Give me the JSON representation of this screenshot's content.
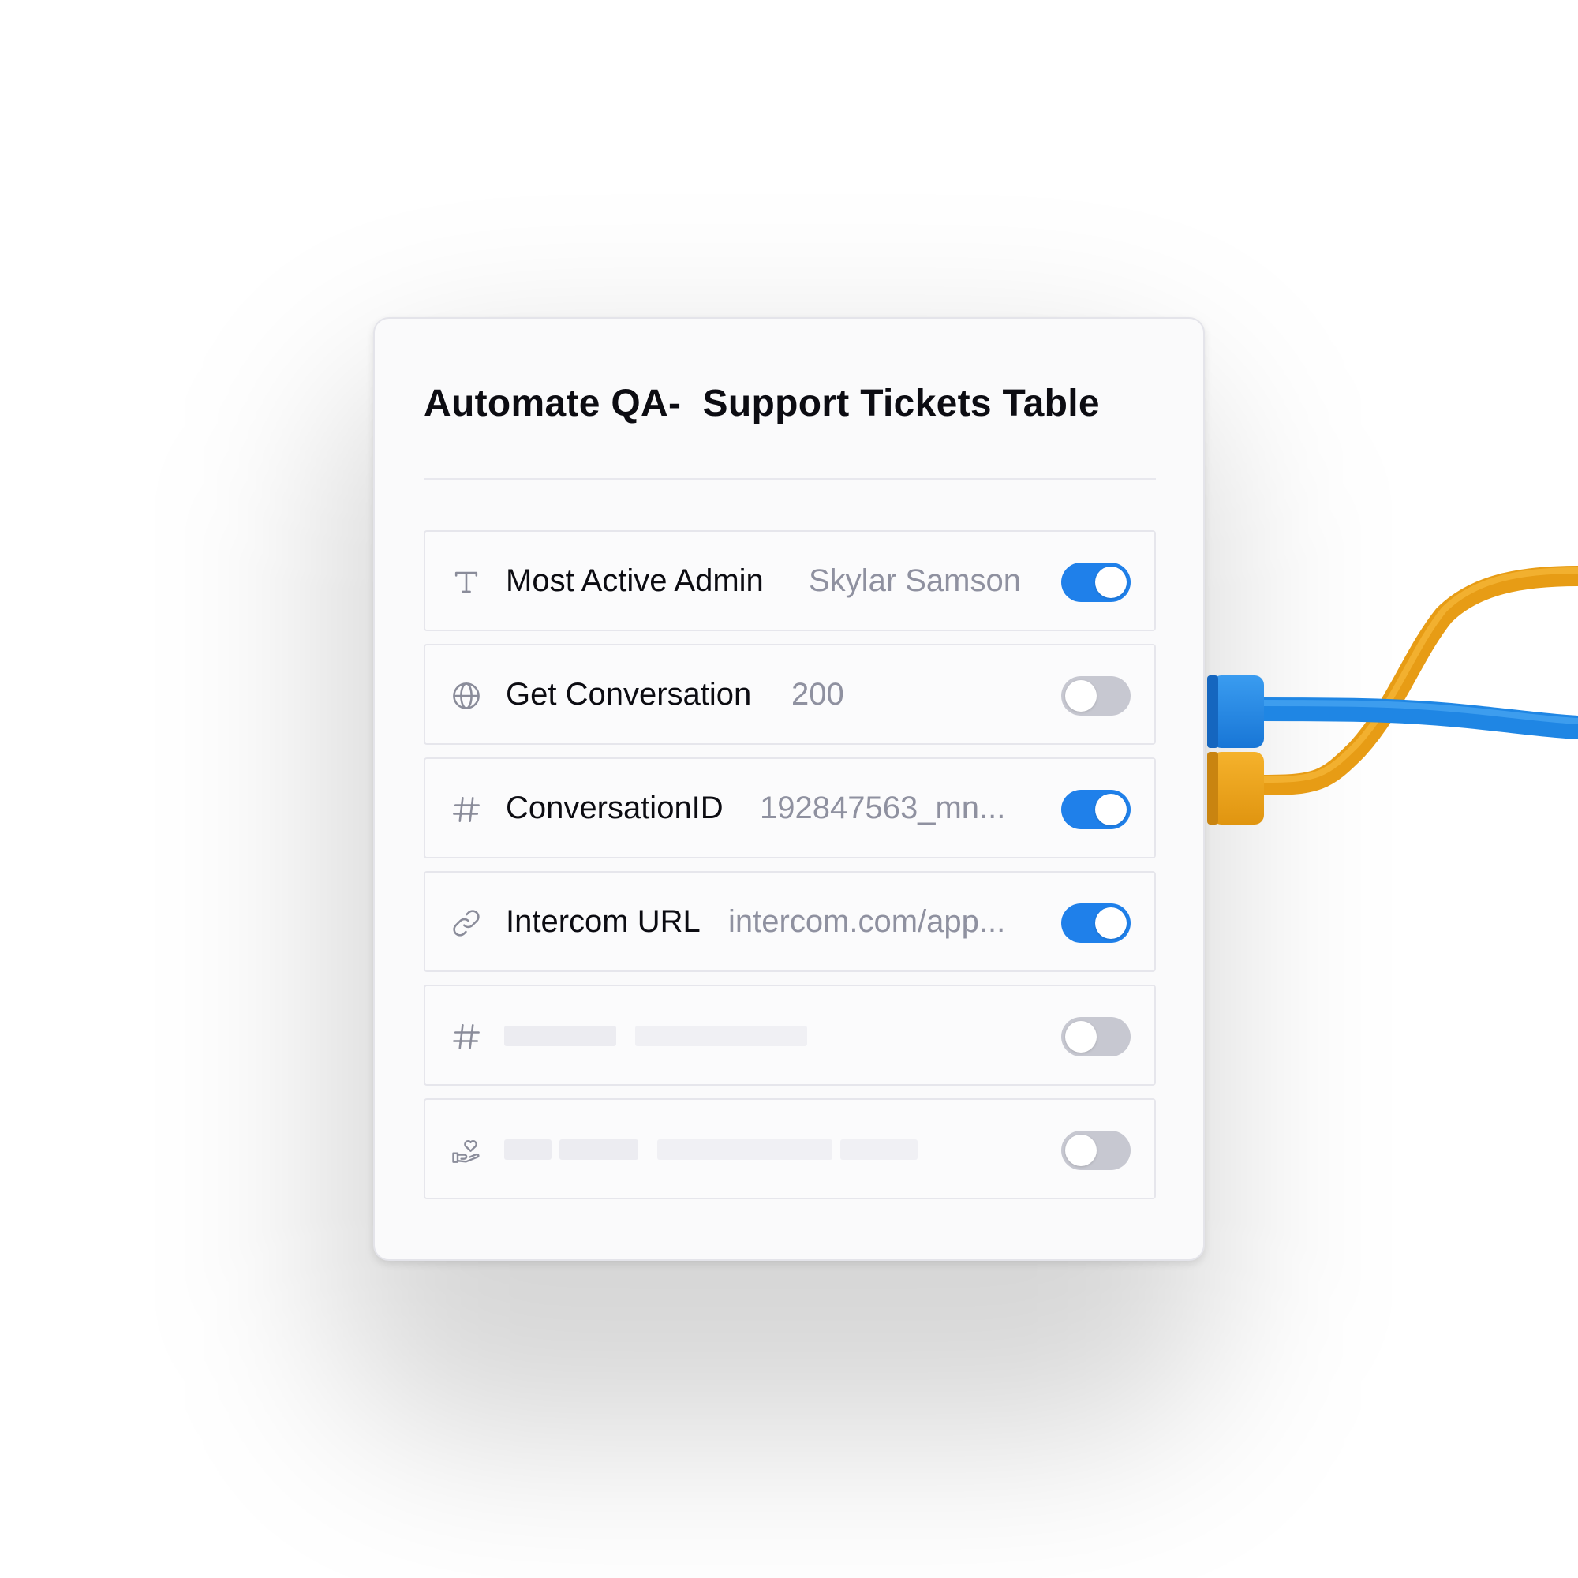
{
  "card": {
    "title": "Automate QA-  Support Tickets Table"
  },
  "fields": [
    {
      "icon": "text-type-icon",
      "label": "Most Active Admin",
      "value": "Skylar Samson",
      "enabled": true
    },
    {
      "icon": "globe-icon",
      "label": "Get Conversation",
      "value": "200",
      "enabled": false
    },
    {
      "icon": "hash-icon",
      "label": "ConversationID",
      "value": "192847563_mn...",
      "enabled": true
    },
    {
      "icon": "link-icon",
      "label": "Intercom URL",
      "value": "intercom.com/app...",
      "enabled": true
    },
    {
      "icon": "hash-icon",
      "label": "",
      "value": "",
      "enabled": false
    },
    {
      "icon": "hand-heart-icon",
      "label": "",
      "value": "",
      "enabled": false
    }
  ],
  "colors": {
    "toggle_on": "#1f80ea",
    "toggle_off": "#c7c8d1",
    "cable_blue": "#1f8ae6",
    "cable_orange": "#f0a51e"
  }
}
